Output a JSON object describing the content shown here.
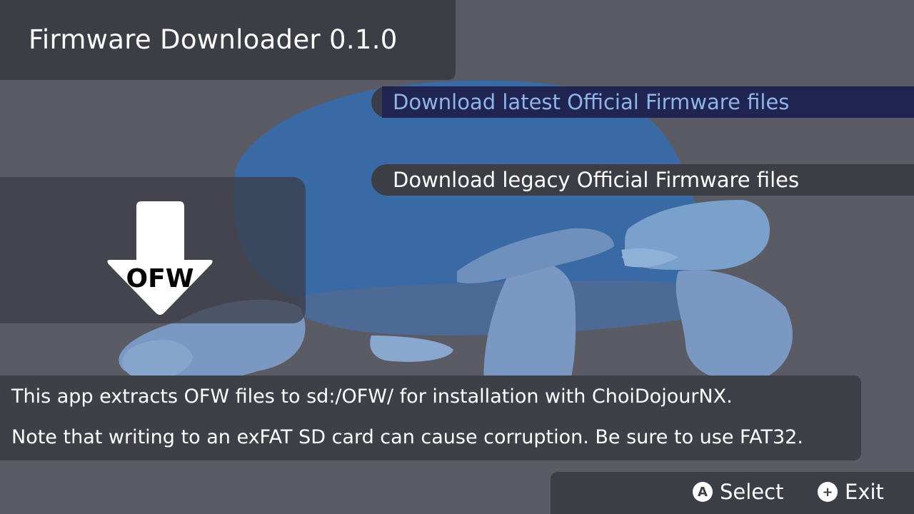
{
  "app": {
    "title": "Firmware Downloader 0.1.0"
  },
  "menu": {
    "items": [
      {
        "label": "Download latest Official Firmware files",
        "selected": true
      },
      {
        "label": "Download legacy Official Firmware files",
        "selected": false
      }
    ]
  },
  "icon": {
    "name": "ofw-download-icon",
    "text": "OFW"
  },
  "info": {
    "line1": "This app extracts OFW files to sd:/OFW/ for installation with ChoiDojourNX.",
    "line2": "Note that writing to an exFAT SD card can cause corruption. Be sure to use FAT32."
  },
  "footer": {
    "select": {
      "glyph": "A",
      "label": "Select"
    },
    "exit": {
      "glyph": "+",
      "label": "Exit"
    }
  },
  "colors": {
    "background": "#5a5b65",
    "panel": "#3d3e45",
    "selection": "#1f2450",
    "selected_text": "#8fb4e8",
    "turtle_dark": "#3a6aa5",
    "turtle_light": "#7aa0cc"
  }
}
